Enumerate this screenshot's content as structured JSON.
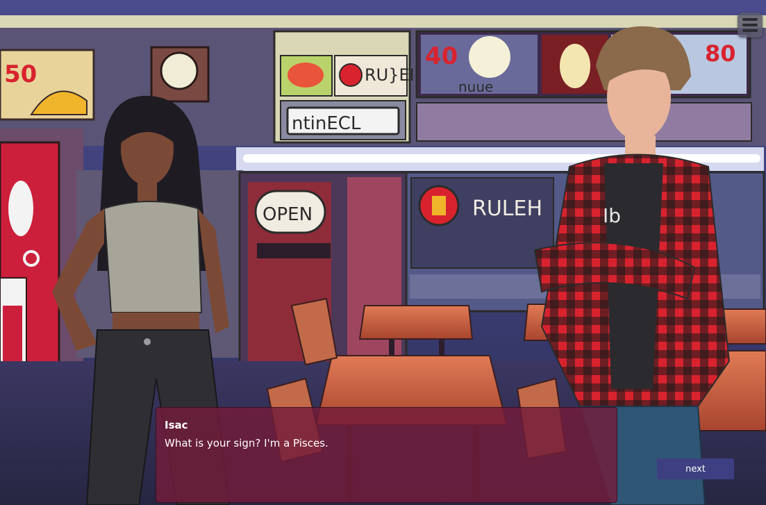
{
  "scene": {
    "background": "food court with fast food stalls, open sign, wooden tables and chairs",
    "characters": [
      {
        "name": "girl-character",
        "hair": "long black",
        "top": "grey tank top",
        "bottoms": "black jeans"
      },
      {
        "name": "isac-character",
        "hair": "wavy light brown",
        "top": "red black plaid flannel over black tee",
        "bottoms": "blue jeans"
      }
    ],
    "signs": {
      "price_left": "50",
      "price_center": "40",
      "price_right": "80",
      "open_sign": "OPEN",
      "stall_sign_1": "RULEH",
      "stall_sign_2": "ntinECL",
      "stall_sign_3": "RU}EI",
      "stall_sign_4": "nuue"
    }
  },
  "menu": {
    "icon": "hamburger-menu-icon"
  },
  "dialog": {
    "speaker": "Isac",
    "text": "What is your sign? I'm a Pisces.",
    "next_label": "next"
  },
  "colors": {
    "dialog_bg": "#731c3a",
    "next_button": "#3d3f82",
    "plaid_red": "#d8232f"
  }
}
